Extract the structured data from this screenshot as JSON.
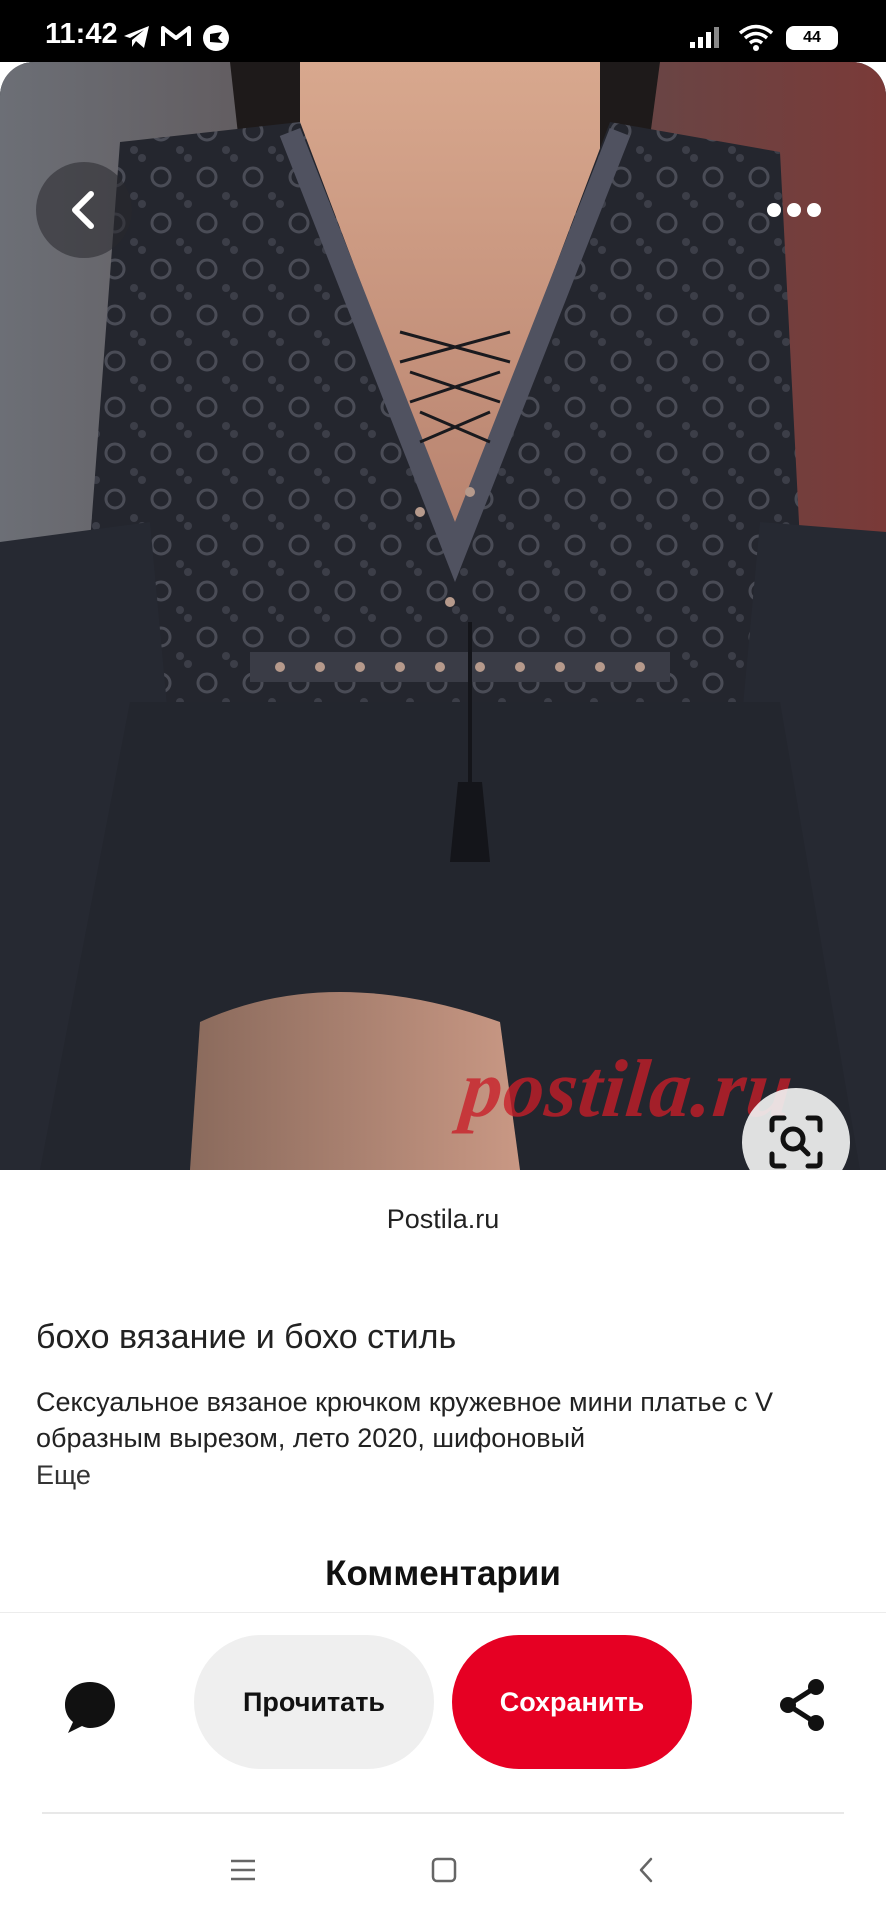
{
  "status_bar": {
    "time": "11:42",
    "battery": "44",
    "icons": [
      "telegram-icon",
      "gmail-icon",
      "app-notification-icon",
      "signal-icon",
      "wifi-icon",
      "battery-icon"
    ]
  },
  "pin": {
    "watermark": "postila.ru",
    "source": "Postila.ru",
    "board_title": "бохо вязание и бохо стиль",
    "description": "Сексуальное вязаное крючком кружевное мини платье с V образным вырезом, лето 2020, шифоновый",
    "more_label": "Еще"
  },
  "comments": {
    "heading": "Комментарии"
  },
  "actions": {
    "read_label": "Прочитать",
    "save_label": "Сохранить",
    "save_color": "#e60023"
  },
  "nav": {
    "icons": [
      "menu-icon",
      "home-icon",
      "back-icon"
    ]
  }
}
